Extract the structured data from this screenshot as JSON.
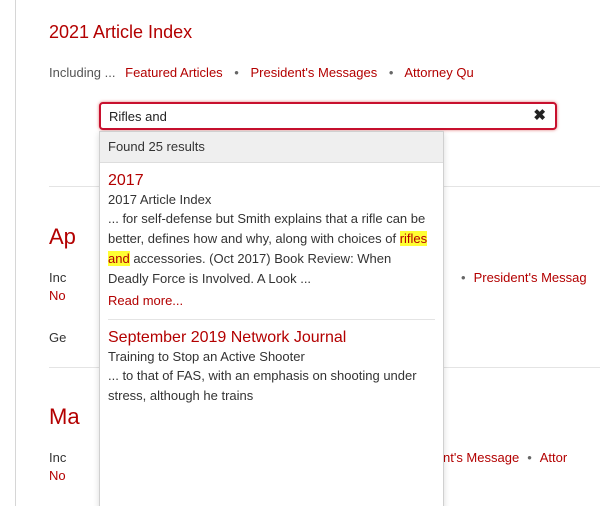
{
  "page": {
    "title": "2021 Article Index",
    "including_prefix": "Including ...",
    "including_links": [
      "Featured Articles",
      "President's Messages",
      "Attorney Qu"
    ],
    "separator": "•"
  },
  "search": {
    "value": "Rifles and",
    "clear_icon": "✖"
  },
  "dropdown": {
    "found_text": "Found 25 results",
    "results": [
      {
        "title": "2017",
        "subtitle": "2017 Article Index",
        "text_before": "... for self-defense but Smith explains that a rifle can be better, defines how and why, along with choices of ",
        "highlight": "rifles and",
        "text_after": " accessories. (Oct 2017) Book Review: When Deadly Force is Involved. A Look ...",
        "read_more": "Read more..."
      },
      {
        "title": "September 2019 Network Journal",
        "subtitle": "Training to Stop an Active Shooter",
        "text_before": "... to that of FAS, with an emphasis on shooting under stress, although he trains"
      }
    ]
  },
  "background": {
    "block1": {
      "heading": "Ap",
      "line1_prefix": "Inc",
      "line1_link": "President's Messag",
      "line2": "No",
      "line3": "Ge"
    },
    "block2": {
      "heading": "Ma",
      "line1_prefix": "Inc",
      "line1_link": "nt's Message",
      "line1_link2": "Attor",
      "line2": "No"
    }
  }
}
